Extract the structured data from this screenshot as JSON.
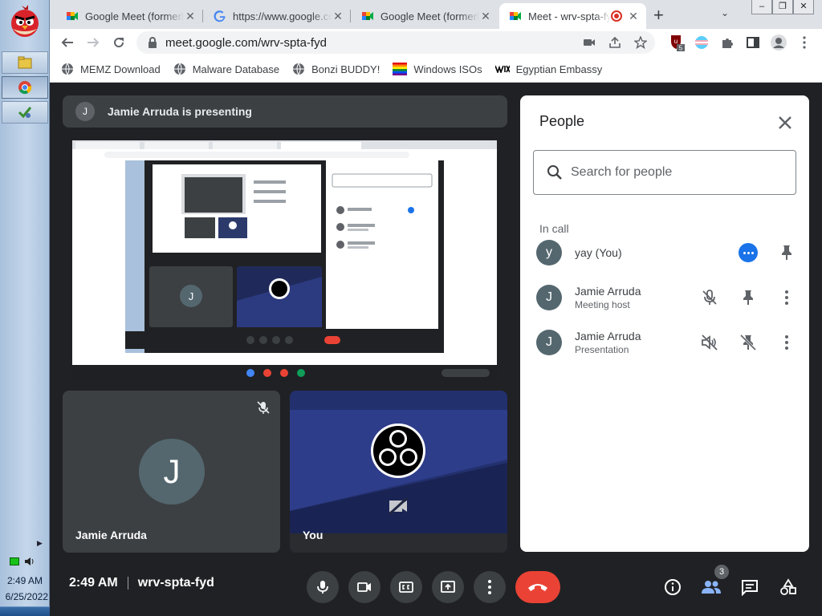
{
  "taskbar": {
    "time": "2:49 AM",
    "date": "6/25/2022"
  },
  "browser": {
    "tabs": [
      {
        "title": "Google Meet (formerly Hangouts Meet)",
        "icon": "google-meet-icon"
      },
      {
        "title": "https://www.google.com/",
        "icon": "google-icon"
      },
      {
        "title": "Google Meet (formerly Hangouts Meet)",
        "icon": "google-meet-icon"
      },
      {
        "title": "Meet - wrv-spta-fyd",
        "icon": "google-meet-icon",
        "active": true,
        "recording": true
      }
    ],
    "url": "meet.google.com/wrv-spta-fyd",
    "extension_badge": "5",
    "bookmarks": [
      {
        "label": "MEMZ Download",
        "icon": "globe-icon"
      },
      {
        "label": "Malware Database",
        "icon": "globe-icon"
      },
      {
        "label": "Bonzi BUDDY!",
        "icon": "globe-icon"
      },
      {
        "label": "Windows ISOs",
        "icon": "rainbow-flag-icon"
      },
      {
        "label": "Egyptian Embassy",
        "icon": "wix-icon"
      }
    ]
  },
  "meet": {
    "presenting_text": "Jamie Arruda is presenting",
    "presenter_initial": "J",
    "tiles": [
      {
        "name": "Jamie Arruda",
        "initial": "J",
        "muted": true
      },
      {
        "name": "You",
        "camera_off": true
      }
    ],
    "time": "2:49 AM",
    "meeting_code": "wrv-spta-fyd",
    "participant_count": "3",
    "accent": "#1a73e8",
    "hangup_color": "#ea4335"
  },
  "people": {
    "title": "People",
    "search_placeholder": "Search for people",
    "section": "In call",
    "members": [
      {
        "initial": "y",
        "name": "yay (You)",
        "sub": ""
      },
      {
        "initial": "J",
        "name": "Jamie Arruda",
        "sub": "Meeting host"
      },
      {
        "initial": "J",
        "name": "Jamie Arruda",
        "sub": "Presentation"
      }
    ]
  }
}
